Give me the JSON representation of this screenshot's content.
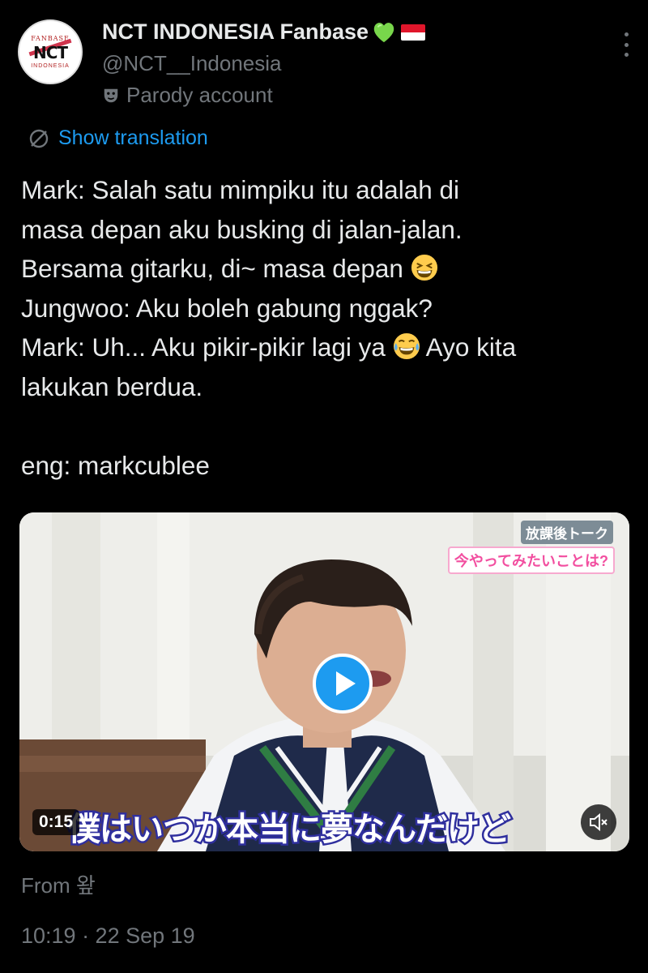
{
  "author": {
    "display_name": "NCT INDONESIA Fanbase",
    "handle": "@NCT__Indonesia",
    "label": "Parody account",
    "avatar_text": {
      "top": "FANBASE",
      "main": "NCT",
      "bottom": "INDONESIA"
    },
    "name_emojis": [
      "green-heart",
      "indonesia-flag"
    ]
  },
  "translate_label": "Show translation",
  "tweet": {
    "lines": [
      "Mark: Salah satu mimpiku itu adalah di",
      "masa depan aku busking di jalan-jalan.",
      "Bersama gitarku, di~ masa depan",
      "Jungwoo: Aku boleh gabung nggak?",
      "Mark: Uh... Aku pikir-pikir lagi ya",
      "lakukan berdua.",
      "eng: markcublee"
    ],
    "line5_tail": "Ayo kita"
  },
  "media": {
    "duration": "0:15",
    "subtitle": "僕はいつか本当に夢なんだけど",
    "tag_top": "放課後トーク",
    "tag_sub": "今やってみたいことは?"
  },
  "source": "From 왚",
  "timestamp": "10:19 · 22 Sep 19",
  "colors": {
    "accent": "#1d9bf0",
    "muted": "#71767b",
    "text": "#e7e9ea",
    "background": "#000000"
  }
}
